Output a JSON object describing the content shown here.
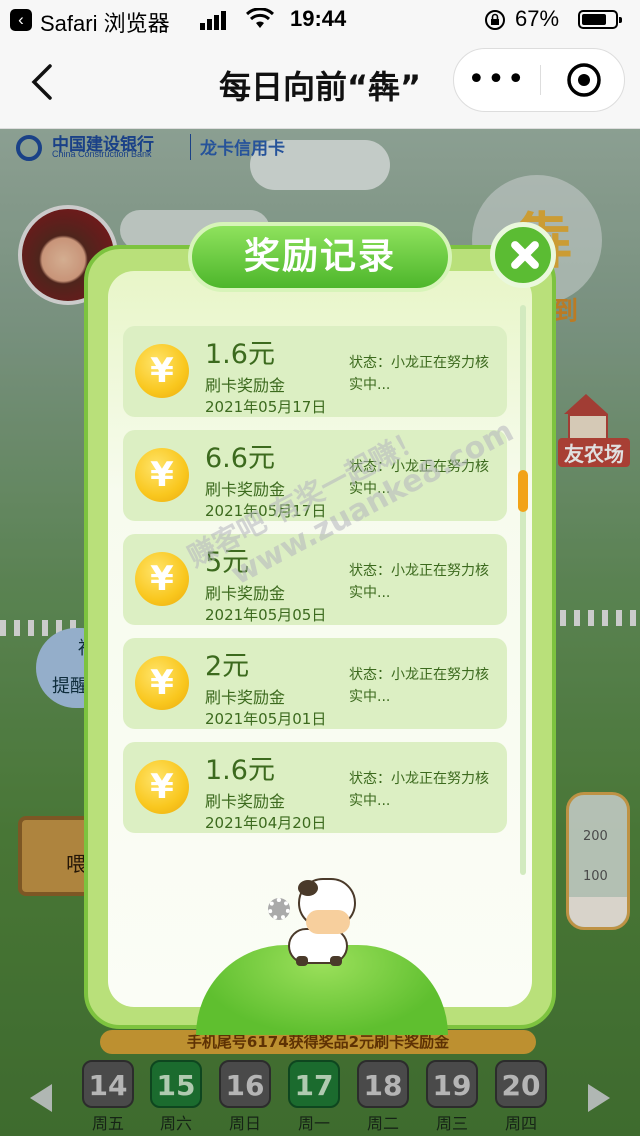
{
  "statusbar": {
    "app": "Safari 浏览器",
    "time": "19:44",
    "battery": "67%"
  },
  "navbar": {
    "title": "每日向前“犇”",
    "back_icon": "chevron-left-icon",
    "more_icon": "more-dots-icon",
    "close_icon": "target-circle-icon"
  },
  "bank": {
    "name_cn": "中国建设银行",
    "name_en": "China Construction Bank",
    "card": "龙卡信用卡"
  },
  "background": {
    "sign_big": "犇",
    "sign_small": "到",
    "farm_label": "友农场",
    "remind_line1": "福",
    "remind_line2": "提醒",
    "feed_label": "喂",
    "bottle_mark_200": "200",
    "bottle_mark_100": "100",
    "winner_text": "手机尾号6174获得奖品2元刷卡奖励金"
  },
  "days": [
    {
      "num": "14",
      "weekday": "周五",
      "done": false
    },
    {
      "num": "15",
      "weekday": "周六",
      "done": true
    },
    {
      "num": "16",
      "weekday": "周日",
      "done": false
    },
    {
      "num": "17",
      "weekday": "周一",
      "done": true
    },
    {
      "num": "18",
      "weekday": "周二",
      "done": false
    },
    {
      "num": "19",
      "weekday": "周三",
      "done": false
    },
    {
      "num": "20",
      "weekday": "周四",
      "done": false
    }
  ],
  "modal": {
    "title": "奖励记录",
    "close_icon": "close-x-icon",
    "records": [
      {
        "amount": "1.6元",
        "kind": "刷卡奖励金",
        "date": "2021年05月17日",
        "status": "状态：小龙正在努力核实中..."
      },
      {
        "amount": "6.6元",
        "kind": "刷卡奖励金",
        "date": "2021年05月17日",
        "status": "状态：小龙正在努力核实中..."
      },
      {
        "amount": "5元",
        "kind": "刷卡奖励金",
        "date": "2021年05月05日",
        "status": "状态：小龙正在努力核实中..."
      },
      {
        "amount": "2元",
        "kind": "刷卡奖励金",
        "date": "2021年05月01日",
        "status": "状态：小龙正在努力核实中..."
      },
      {
        "amount": "1.6元",
        "kind": "刷卡奖励金",
        "date": "2021年04月20日",
        "status": "状态：小龙正在努力核实中..."
      }
    ],
    "coin_symbol": "¥"
  },
  "watermark": {
    "line1": "赚客吧  有奖一起赚！",
    "line2": "www.zuanke8.com"
  }
}
